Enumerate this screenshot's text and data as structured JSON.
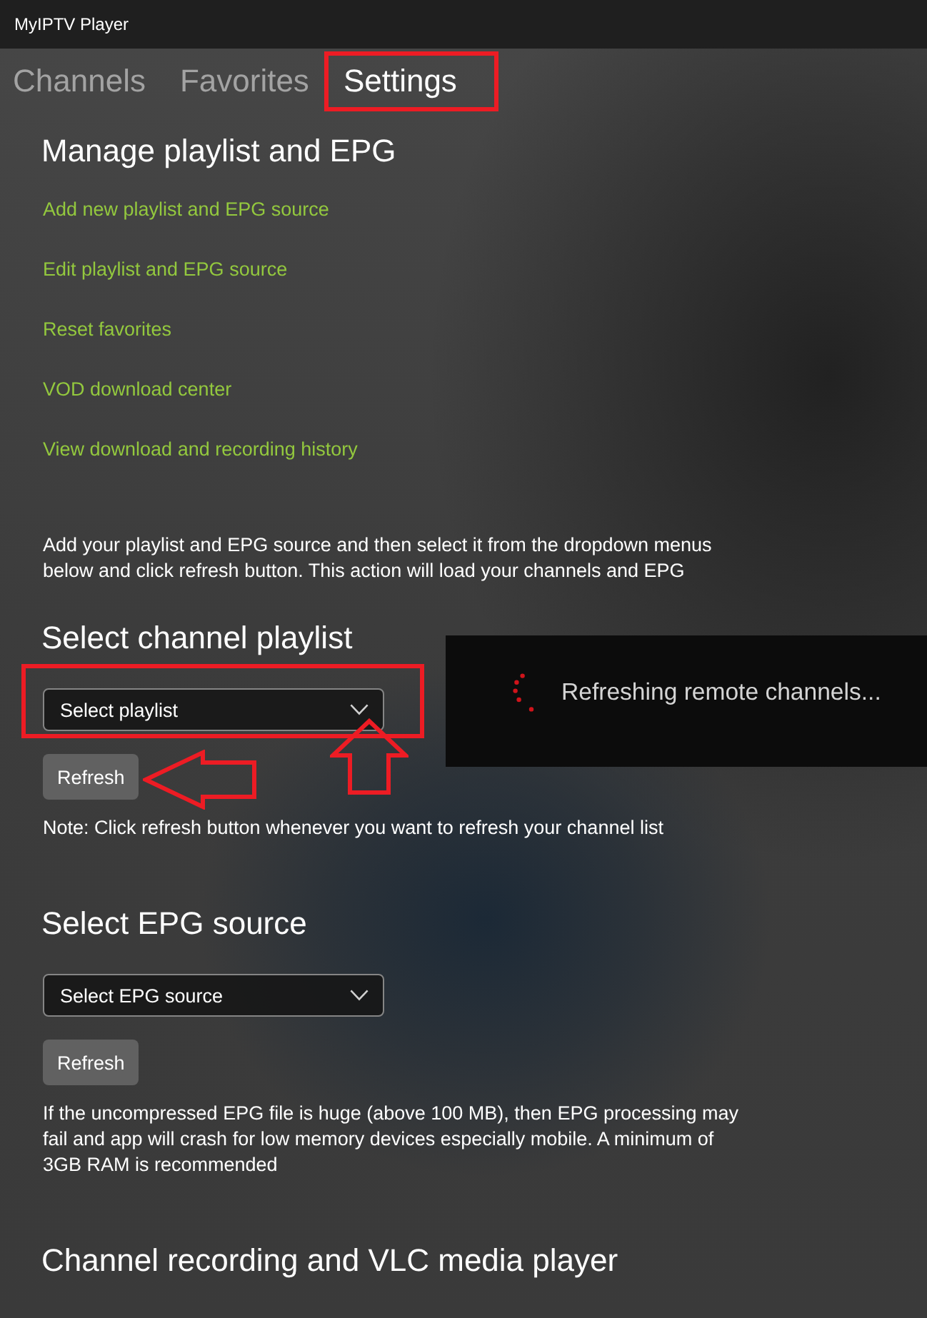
{
  "window": {
    "title": "MyIPTV Player"
  },
  "tabs": [
    {
      "label": "Channels",
      "selected": false
    },
    {
      "label": "Favorites",
      "selected": false
    },
    {
      "label": "Settings",
      "selected": true,
      "highlighted": true
    }
  ],
  "sections": [
    {
      "kind": "links",
      "heading": "Manage playlist and EPG",
      "links": [
        "Add new playlist and EPG source",
        "Edit playlist and EPG source",
        "Reset favorites",
        "VOD download center",
        "View download and recording history"
      ],
      "description": "Add your playlist and EPG source and then select it from the dropdown menus below and click refresh button. This action will load your channels and EPG"
    },
    {
      "kind": "picker",
      "heading": "Select channel playlist",
      "dropdown": {
        "placeholder": "Select playlist",
        "highlighted": true,
        "pointer_arrow": true
      },
      "button": {
        "label": "Refresh",
        "pointer_arrow": true
      },
      "note": "Note: Click refresh button whenever you want to refresh your channel list"
    },
    {
      "kind": "picker",
      "heading": "Select EPG source",
      "dropdown": {
        "placeholder": "Select EPG source"
      },
      "button": {
        "label": "Refresh"
      },
      "note": "If the uncompressed EPG file is huge (above 100 MB), then EPG processing may fail and app will crash for low memory devices especially mobile. A minimum of 3GB RAM is recommended"
    },
    {
      "kind": "heading",
      "heading": "Channel recording and VLC media player"
    }
  ],
  "overlay": {
    "message": "Refreshing remote channels..."
  }
}
